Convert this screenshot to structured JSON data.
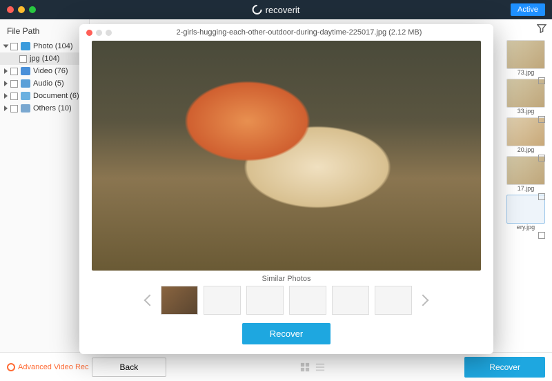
{
  "app": {
    "name": "recoverit",
    "active_button": "Active"
  },
  "sidebar": {
    "title": "File Path",
    "items": [
      {
        "label": "Photo (104)",
        "open": true
      },
      {
        "label": "jpg (104)",
        "child": true,
        "selected": true
      },
      {
        "label": "Video (76)"
      },
      {
        "label": "Audio (5)"
      },
      {
        "label": "Document (6)"
      },
      {
        "label": "Others (10)"
      }
    ]
  },
  "thumbs": [
    {
      "label": "73.jpg"
    },
    {
      "label": "33.jpg"
    },
    {
      "label": "20.jpg"
    },
    {
      "label": "17.jpg"
    },
    {
      "label": "ery.jpg"
    }
  ],
  "footer": {
    "advanced": "Advanced Video Rec",
    "back": "Back",
    "recover": "Recover"
  },
  "modal": {
    "filename": "2-girls-hugging-each-other-outdoor-during-daytime-225017.jpg (2.12 MB)",
    "similar_title": "Similar Photos",
    "recover": "Recover"
  }
}
